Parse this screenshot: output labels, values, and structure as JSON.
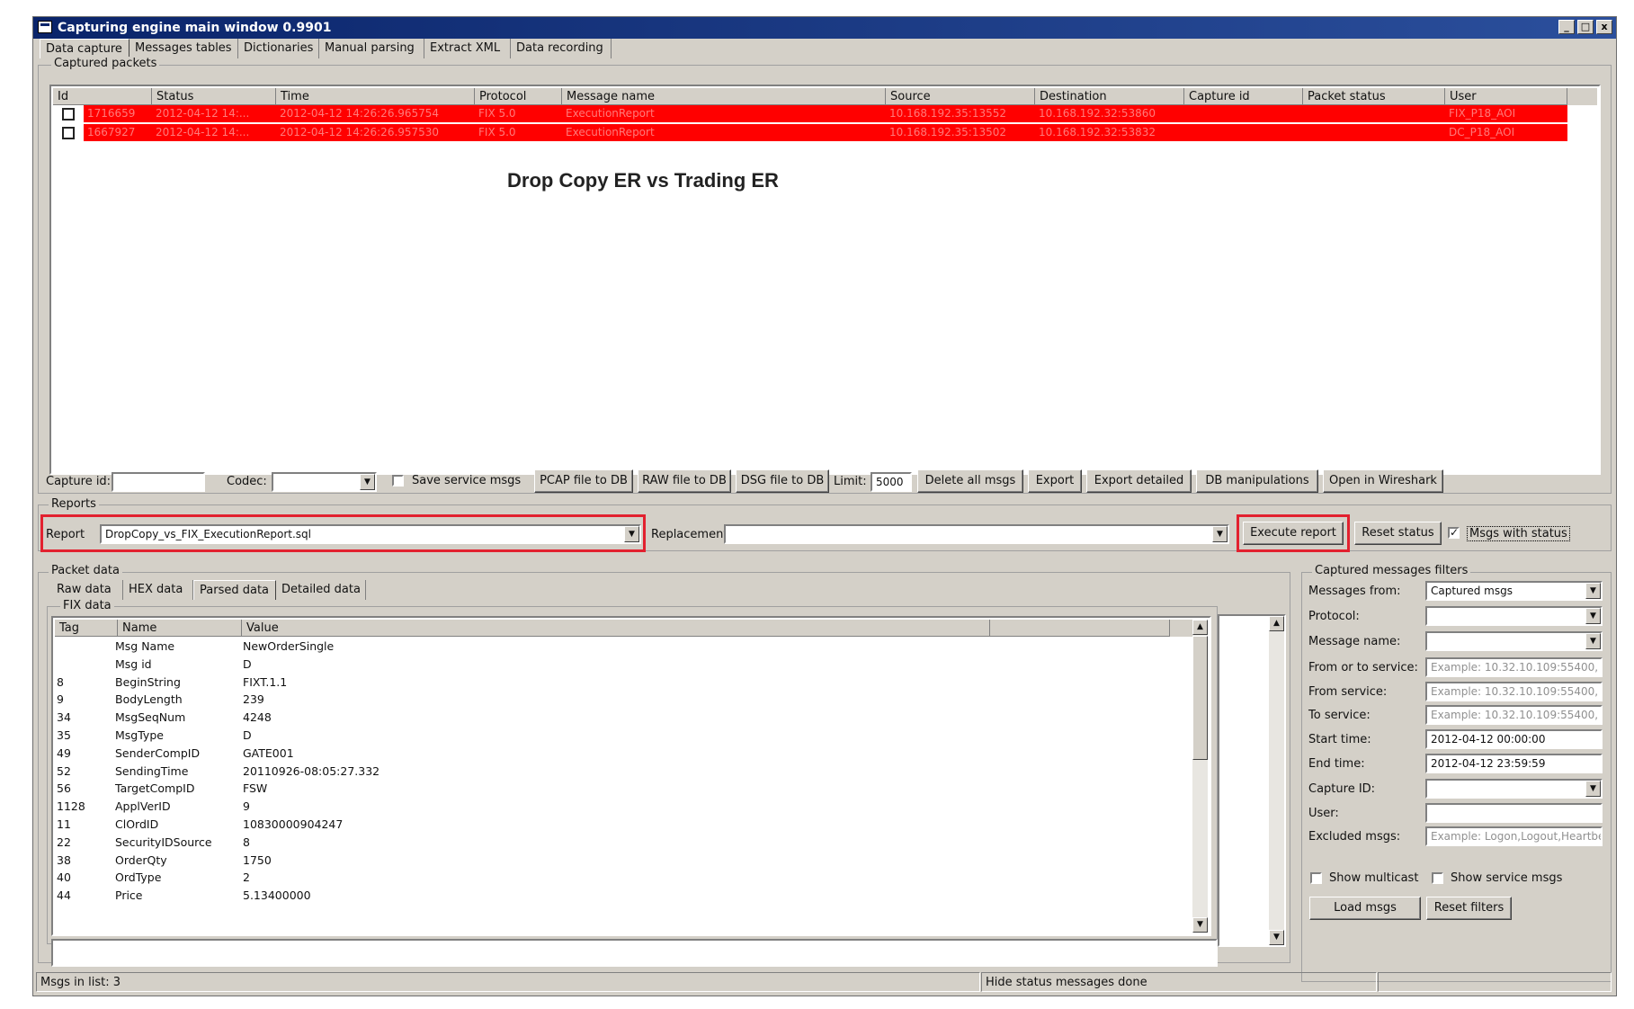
{
  "window": {
    "title": "Capturing engine main window 0.9901",
    "min": "_",
    "max": "□",
    "close": "x"
  },
  "main_tabs": [
    "Data capture",
    "Messages tables",
    "Dictionaries",
    "Manual parsing",
    "Extract XML",
    "Data recording"
  ],
  "captured_packets": {
    "label": "Captured packets",
    "columns": [
      "Id",
      "Status",
      "Time",
      "Protocol",
      "Message name",
      "Source",
      "Destination",
      "Capture id",
      "Packet status",
      "User"
    ],
    "rows": [
      [
        "1716659",
        "2012-04-12 14:...",
        "2012-04-12 14:26:26.965754",
        "FIX 5.0",
        "ExecutionReport",
        "10.168.192.35:13552",
        "10.168.192.32:53860",
        "",
        "",
        "FIX_P18_AOI"
      ],
      [
        "1667927",
        "2012-04-12 14:...",
        "2012-04-12 14:26:26.957530",
        "FIX 5.0",
        "ExecutionReport",
        "10.168.192.35:13502",
        "10.168.192.32:53832",
        "",
        "",
        "DC_P18_AOI"
      ]
    ],
    "overlay_text": "Drop Copy ER vs Trading ER"
  },
  "toolbar": {
    "capture_id_label": "Capture id:",
    "capture_id_value": "",
    "codec_label": "Codec:",
    "codec_value": "",
    "save_service_msgs": "Save service msgs",
    "pcap_to_db": "PCAP file to DB",
    "raw_to_db": "RAW file to DB",
    "dsg_to_db": "DSG file to DB",
    "limit_label": "Limit:",
    "limit_value": "5000",
    "delete_all": "Delete all msgs",
    "export": "Export",
    "export_detailed": "Export detailed",
    "db_manipulations": "DB manipulations",
    "open_wireshark": "Open in Wireshark"
  },
  "reports": {
    "group_label": "Reports",
    "report_label": "Report",
    "report_value": "DropCopy_vs_FIX_ExecutionReport.sql",
    "replacement_label": "Replacement",
    "replacement_value": "",
    "execute": "Execute report",
    "reset_status": "Reset status",
    "msgs_with_status": "Msgs with status",
    "msgs_with_status_checked": "✓"
  },
  "packet_data": {
    "label": "Packet data",
    "tabs": [
      "Raw data",
      "HEX data",
      "Parsed data",
      "Detailed data"
    ],
    "fix_label": "FIX data",
    "columns": [
      "Tag",
      "Name",
      "Value"
    ],
    "rows": [
      [
        "",
        "Msg Name",
        "NewOrderSingle"
      ],
      [
        "",
        "Msg id",
        "D"
      ],
      [
        "8",
        "BeginString",
        "FIXT.1.1"
      ],
      [
        "9",
        "BodyLength",
        "239"
      ],
      [
        "34",
        "MsgSeqNum",
        "4248"
      ],
      [
        "35",
        "MsgType",
        "D"
      ],
      [
        "49",
        "SenderCompID",
        "GATE001"
      ],
      [
        "52",
        "SendingTime",
        "20110926-08:05:27.332"
      ],
      [
        "56",
        "TargetCompID",
        "FSW"
      ],
      [
        "1128",
        "ApplVerID",
        "9"
      ],
      [
        "11",
        "ClOrdID",
        "10830000904247"
      ],
      [
        "22",
        "SecurityIDSource",
        "8"
      ],
      [
        "38",
        "OrderQty",
        "1750"
      ],
      [
        "40",
        "OrdType",
        "2"
      ],
      [
        "44",
        "Price",
        "5.13400000"
      ]
    ]
  },
  "filters": {
    "label": "Captured messages filters",
    "fields": [
      {
        "label": "Messages from:",
        "value": "Captured msgs",
        "kind": "combo"
      },
      {
        "label": "Protocol:",
        "value": "",
        "kind": "combo"
      },
      {
        "label": "Message name:",
        "value": "",
        "kind": "combo"
      },
      {
        "label": "From or to service:",
        "value": "Example: 10.32.10.109:55400,",
        "kind": "placeholder"
      },
      {
        "label": "From service:",
        "value": "Example: 10.32.10.109:55400,",
        "kind": "placeholder"
      },
      {
        "label": "To service:",
        "value": "Example: 10.32.10.109:55400,",
        "kind": "placeholder"
      },
      {
        "label": "Start time:",
        "value": "2012-04-12 00:00:00",
        "kind": "text"
      },
      {
        "label": "End time:",
        "value": "2012-04-12 23:59:59",
        "kind": "text"
      },
      {
        "label": "Capture ID:",
        "value": "",
        "kind": "combo"
      },
      {
        "label": "User:",
        "value": "",
        "kind": "text"
      },
      {
        "label": "Excluded msgs:",
        "value": "Example: Logon,Logout,Heartbe",
        "kind": "placeholder"
      }
    ],
    "show_multicast": "Show multicast",
    "show_service_msgs": "Show service msgs",
    "load_msgs": "Load msgs",
    "reset_filters": "Reset filters"
  },
  "statusbar": {
    "left": "Msgs in list: 3",
    "middle": "Hide status messages done"
  },
  "colors": {
    "title_bar": "#0a246a",
    "highlight_row": "#ff0000",
    "annotation_box": "#e2212f",
    "chrome": "#d4d0c8"
  }
}
